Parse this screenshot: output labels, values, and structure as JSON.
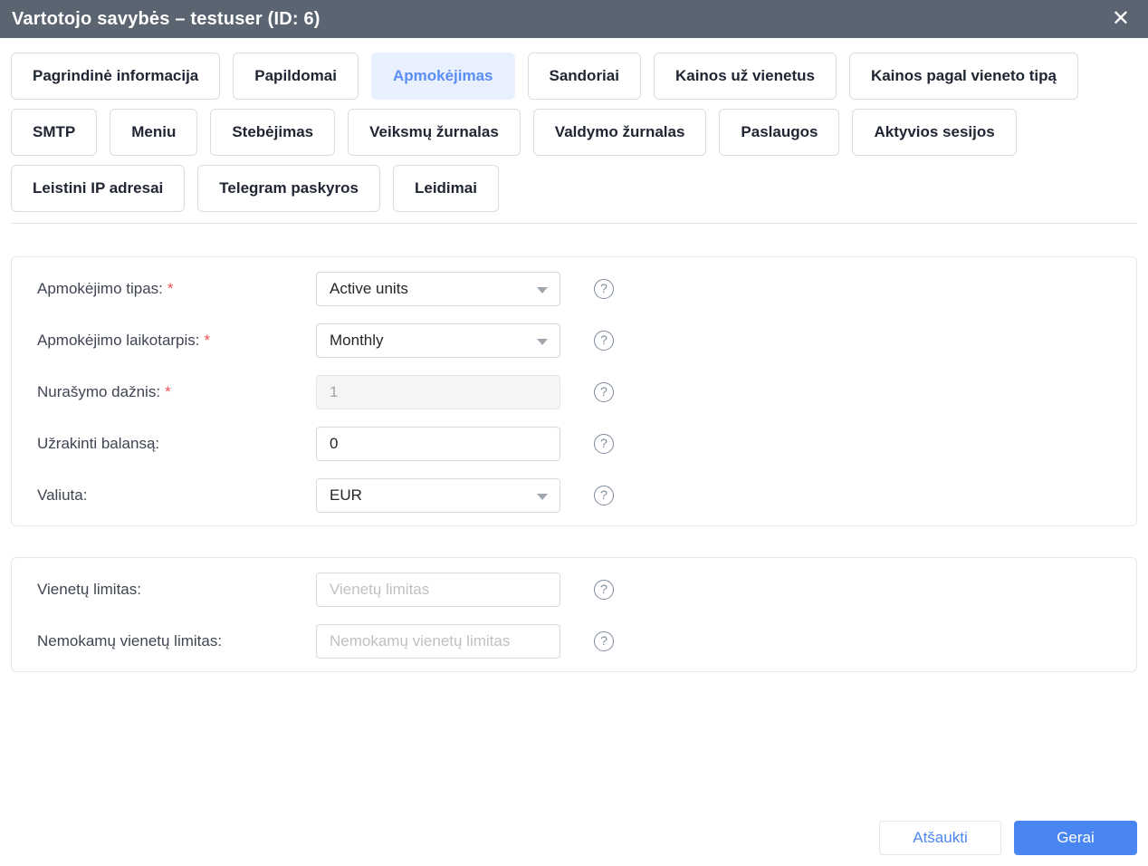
{
  "header": {
    "title": "Vartotojo savybės – testuser (ID: 6)"
  },
  "icons": {
    "close": "✕",
    "help": "?"
  },
  "required_marker": "*",
  "tabs": [
    {
      "label": "Pagrindinė informacija",
      "active": false
    },
    {
      "label": "Papildomai",
      "active": false
    },
    {
      "label": "Apmokėjimas",
      "active": true
    },
    {
      "label": "Sandoriai",
      "active": false
    },
    {
      "label": "Kainos už vienetus",
      "active": false
    },
    {
      "label": "Kainos pagal vieneto tipą",
      "active": false
    },
    {
      "label": "SMTP",
      "active": false
    },
    {
      "label": "Meniu",
      "active": false
    },
    {
      "label": "Stebėjimas",
      "active": false
    },
    {
      "label": "Veiksmų žurnalas",
      "active": false
    },
    {
      "label": "Valdymo žurnalas",
      "active": false
    },
    {
      "label": "Paslaugos",
      "active": false
    },
    {
      "label": "Aktyvios sesijos",
      "active": false
    },
    {
      "label": "Leistini IP adresai",
      "active": false
    },
    {
      "label": "Telegram paskyros",
      "active": false
    },
    {
      "label": "Leidimai",
      "active": false
    }
  ],
  "form": {
    "sections": [
      {
        "fields": [
          {
            "label": "Apmokėjimo tipas:",
            "required": true,
            "type": "select",
            "value": "Active units"
          },
          {
            "label": "Apmokėjimo laikotarpis:",
            "required": true,
            "type": "select",
            "value": "Monthly"
          },
          {
            "label": "Nurašymo dažnis:",
            "required": true,
            "type": "input",
            "value": "1",
            "disabled": true
          },
          {
            "label": "Užrakinti balansą:",
            "required": false,
            "type": "input",
            "value": "0"
          },
          {
            "label": "Valiuta:",
            "required": false,
            "type": "select",
            "value": "EUR"
          }
        ]
      },
      {
        "fields": [
          {
            "label": "Vienetų limitas:",
            "required": false,
            "type": "input",
            "value": "",
            "placeholder": "Vienetų limitas"
          },
          {
            "label": "Nemokamų vienetų limitas:",
            "required": false,
            "type": "input",
            "value": "",
            "placeholder": "Nemokamų vienetų limitas"
          }
        ]
      }
    ]
  },
  "footer": {
    "cancel_label": "Atšaukti",
    "ok_label": "Gerai"
  },
  "colors": {
    "header_bg": "#5b6571",
    "active_tab_bg": "#e9f0fd",
    "active_tab_text": "#5a8df5",
    "accent_blue": "#4a86f2",
    "required_red": "#f05252"
  }
}
